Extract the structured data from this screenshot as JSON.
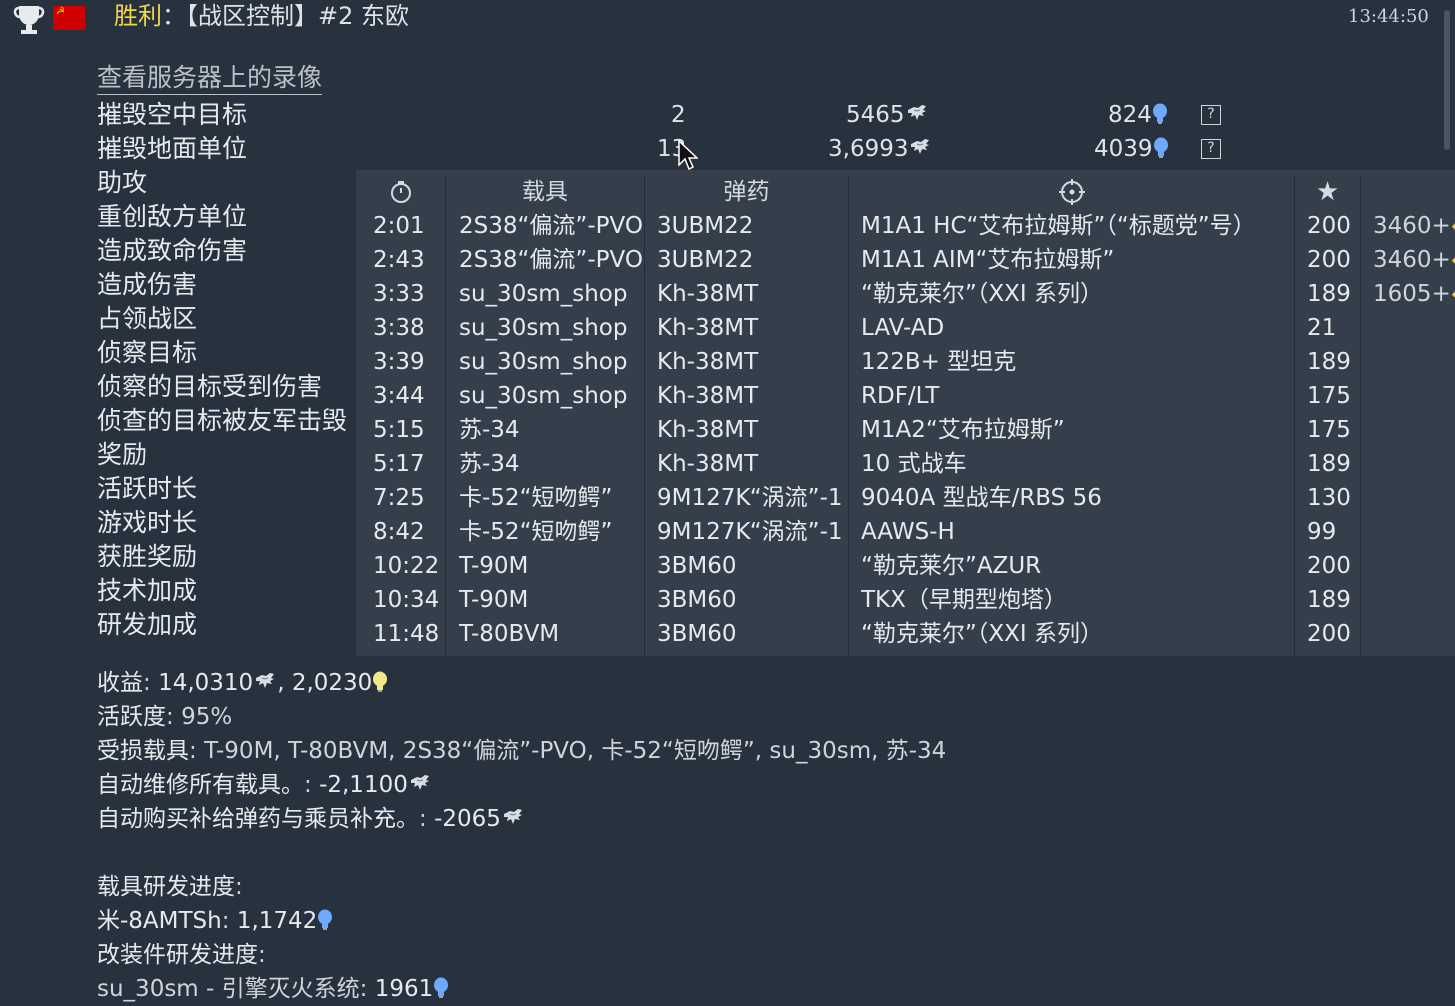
{
  "header": {
    "result": "胜利",
    "separator": "：",
    "mission": "【战区控制】#2 东欧",
    "time": "13:44:50"
  },
  "replay_link": "查看服务器上的录像",
  "stats": [
    {
      "label": "摧毁空中目标",
      "count": "2",
      "silver": "5465",
      "rp": "824"
    },
    {
      "label": "摧毁地面单位",
      "count": "13",
      "silver": "3,6993",
      "rp": "4039"
    },
    {
      "label": "助攻"
    },
    {
      "label": "重创敌方单位"
    },
    {
      "label": "造成致命伤害"
    },
    {
      "label": "造成伤害"
    },
    {
      "label": "占领战区"
    },
    {
      "label": "侦察目标"
    },
    {
      "label": "侦察的目标受到伤害"
    },
    {
      "label": "侦查的目标被友军击毁"
    },
    {
      "label": "奖励"
    },
    {
      "label": "活跃时长"
    },
    {
      "label": "游戏时长"
    },
    {
      "label": "获胜奖励"
    },
    {
      "label": "技术加成"
    },
    {
      "label": "研发加成"
    }
  ],
  "kills_table": {
    "headers": {
      "time_icon": "timer-icon",
      "vehicle": "载具",
      "ammo": "弹药",
      "target_icon": "crosshair-icon",
      "score_icon": "star-icon"
    },
    "rows": [
      {
        "time": "2:01",
        "vehicle": "2S38“偏流”-PVO",
        "ammo": "3UBM22",
        "target": "M1A1 HC“艾布拉姆斯”（“标题党”号）",
        "score": "200",
        "reward": "3460+"
      },
      {
        "time": "2:43",
        "vehicle": "2S38“偏流”-PVO",
        "ammo": "3UBM22",
        "target": "M1A1 AIM“艾布拉姆斯”",
        "score": "200",
        "reward": "3460+"
      },
      {
        "time": "3:33",
        "vehicle": "su_30sm_shop",
        "ammo": "Kh-38MT",
        "target": "“勒克莱尔”（XXI 系列）",
        "score": "189",
        "reward": "1605+"
      },
      {
        "time": "3:38",
        "vehicle": "su_30sm_shop",
        "ammo": "Kh-38MT",
        "target": "LAV-AD",
        "score": "21",
        "reward": ""
      },
      {
        "time": "3:39",
        "vehicle": "su_30sm_shop",
        "ammo": "Kh-38MT",
        "target": "122B+ 型坦克",
        "score": "189",
        "reward": ""
      },
      {
        "time": "3:44",
        "vehicle": "su_30sm_shop",
        "ammo": "Kh-38MT",
        "target": "RDF/LT",
        "score": "175",
        "reward": ""
      },
      {
        "time": "5:15",
        "vehicle": "苏-34",
        "ammo": "Kh-38MT",
        "target": "M1A2“艾布拉姆斯”",
        "score": "175",
        "reward": ""
      },
      {
        "time": "5:17",
        "vehicle": "苏-34",
        "ammo": "Kh-38MT",
        "target": "10 式战车",
        "score": "189",
        "reward": ""
      },
      {
        "time": "7:25",
        "vehicle": "卡-52“短吻鳄”",
        "ammo": "9M127K“涡流”-1",
        "target": "9040A 型战车/RBS 56",
        "score": "130",
        "reward": ""
      },
      {
        "time": "8:42",
        "vehicle": "卡-52“短吻鳄”",
        "ammo": "9M127K“涡流”-1",
        "target": "AAWS-H",
        "score": "99",
        "reward": ""
      },
      {
        "time": "10:22",
        "vehicle": "T-90M",
        "ammo": "3BM60",
        "target": "“勒克莱尔”AZUR",
        "score": "200",
        "reward": ""
      },
      {
        "time": "10:34",
        "vehicle": "T-90M",
        "ammo": "3BM60",
        "target": "TKX（早期型炮塔）",
        "score": "189",
        "reward": ""
      },
      {
        "time": "11:48",
        "vehicle": "T-80BVM",
        "ammo": "3BM60",
        "target": "“勒克莱尔”（XXI 系列）",
        "score": "200",
        "reward": ""
      }
    ]
  },
  "summary": {
    "earnings_label": "收益",
    "earnings_silver": "14,0310",
    "earnings_rp": "2,0230",
    "activity_label": "活跃度",
    "activity_value": "95%",
    "damaged_label": "受损载具",
    "damaged_value": "T-90M, T-80BVM, 2S38“偏流”-PVO, 卡-52“短吻鳄”, su_30sm, 苏-34",
    "repair_label": "自动维修所有载具。",
    "repair_value": "-2,1100",
    "resupply_label": "自动购买补给弹药与乘员补充。",
    "resupply_value": "-2065",
    "vehicle_research_title": "载具研发进度",
    "vehicle_research_name": "米-8AMTSh",
    "vehicle_research_value": "1,1742",
    "mod_research_title": "改装件研发进度",
    "mod_research_name": "su_30sm - 引擎灭火系统",
    "mod_research_value": "1961"
  },
  "colors": {
    "background": "#28323e",
    "popup": "#343f4b",
    "victory": "#f1d64b",
    "rp_blue": "#6fa8ff",
    "bulb_yellow": "#f2e88a"
  }
}
